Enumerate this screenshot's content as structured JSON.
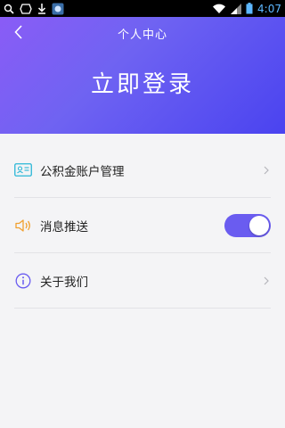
{
  "status_bar": {
    "time": "4:07",
    "icons": [
      "search-icon",
      "diamond-icon",
      "download-icon",
      "app-icon",
      "wifi-icon",
      "signal-icon",
      "battery-icon"
    ]
  },
  "header": {
    "title": "个人中心",
    "login_label": "立即登录",
    "back_icon": "back-chevron-icon"
  },
  "menu": {
    "items": [
      {
        "label": "公积金账户管理",
        "icon": "id-card-icon",
        "accessory": "chevron-right-icon"
      },
      {
        "label": "消息推送",
        "icon": "speaker-icon",
        "accessory": "toggle",
        "enabled": true
      },
      {
        "label": "关于我们",
        "icon": "info-icon",
        "accessory": "chevron-right-icon"
      }
    ]
  },
  "colors": {
    "header_gradient_start": "#8a5cf6",
    "header_gradient_end": "#4a43f0",
    "toggle_on": "#6a5cf0",
    "id_card_icon": "#29b6d6",
    "speaker_icon": "#f0a030",
    "info_icon": "#6a5cf0",
    "background": "#f4f4f6"
  }
}
